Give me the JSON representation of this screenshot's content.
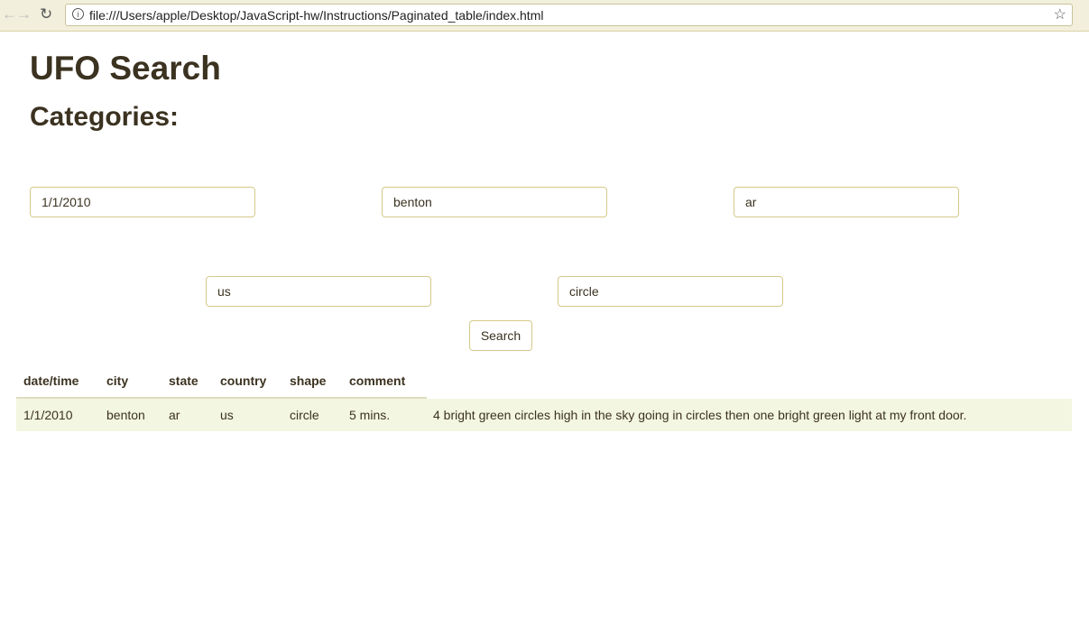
{
  "browser": {
    "url": "file:///Users/apple/Desktop/JavaScript-hw/Instructions/Paginated_table/index.html"
  },
  "page": {
    "title": "UFO Search",
    "subtitle": "Categories:"
  },
  "filters": {
    "date": "1/1/2010",
    "city": "benton",
    "state": "ar",
    "country": "us",
    "shape": "circle"
  },
  "search_label": "Search",
  "table": {
    "headers": [
      "date/time",
      "city",
      "state",
      "country",
      "shape",
      "comment"
    ],
    "rows": [
      [
        "1/1/2010",
        "benton",
        "ar",
        "us",
        "circle",
        "5 mins.",
        "4 bright green circles high in the sky going in circles then one bright green light at my front door."
      ]
    ]
  }
}
